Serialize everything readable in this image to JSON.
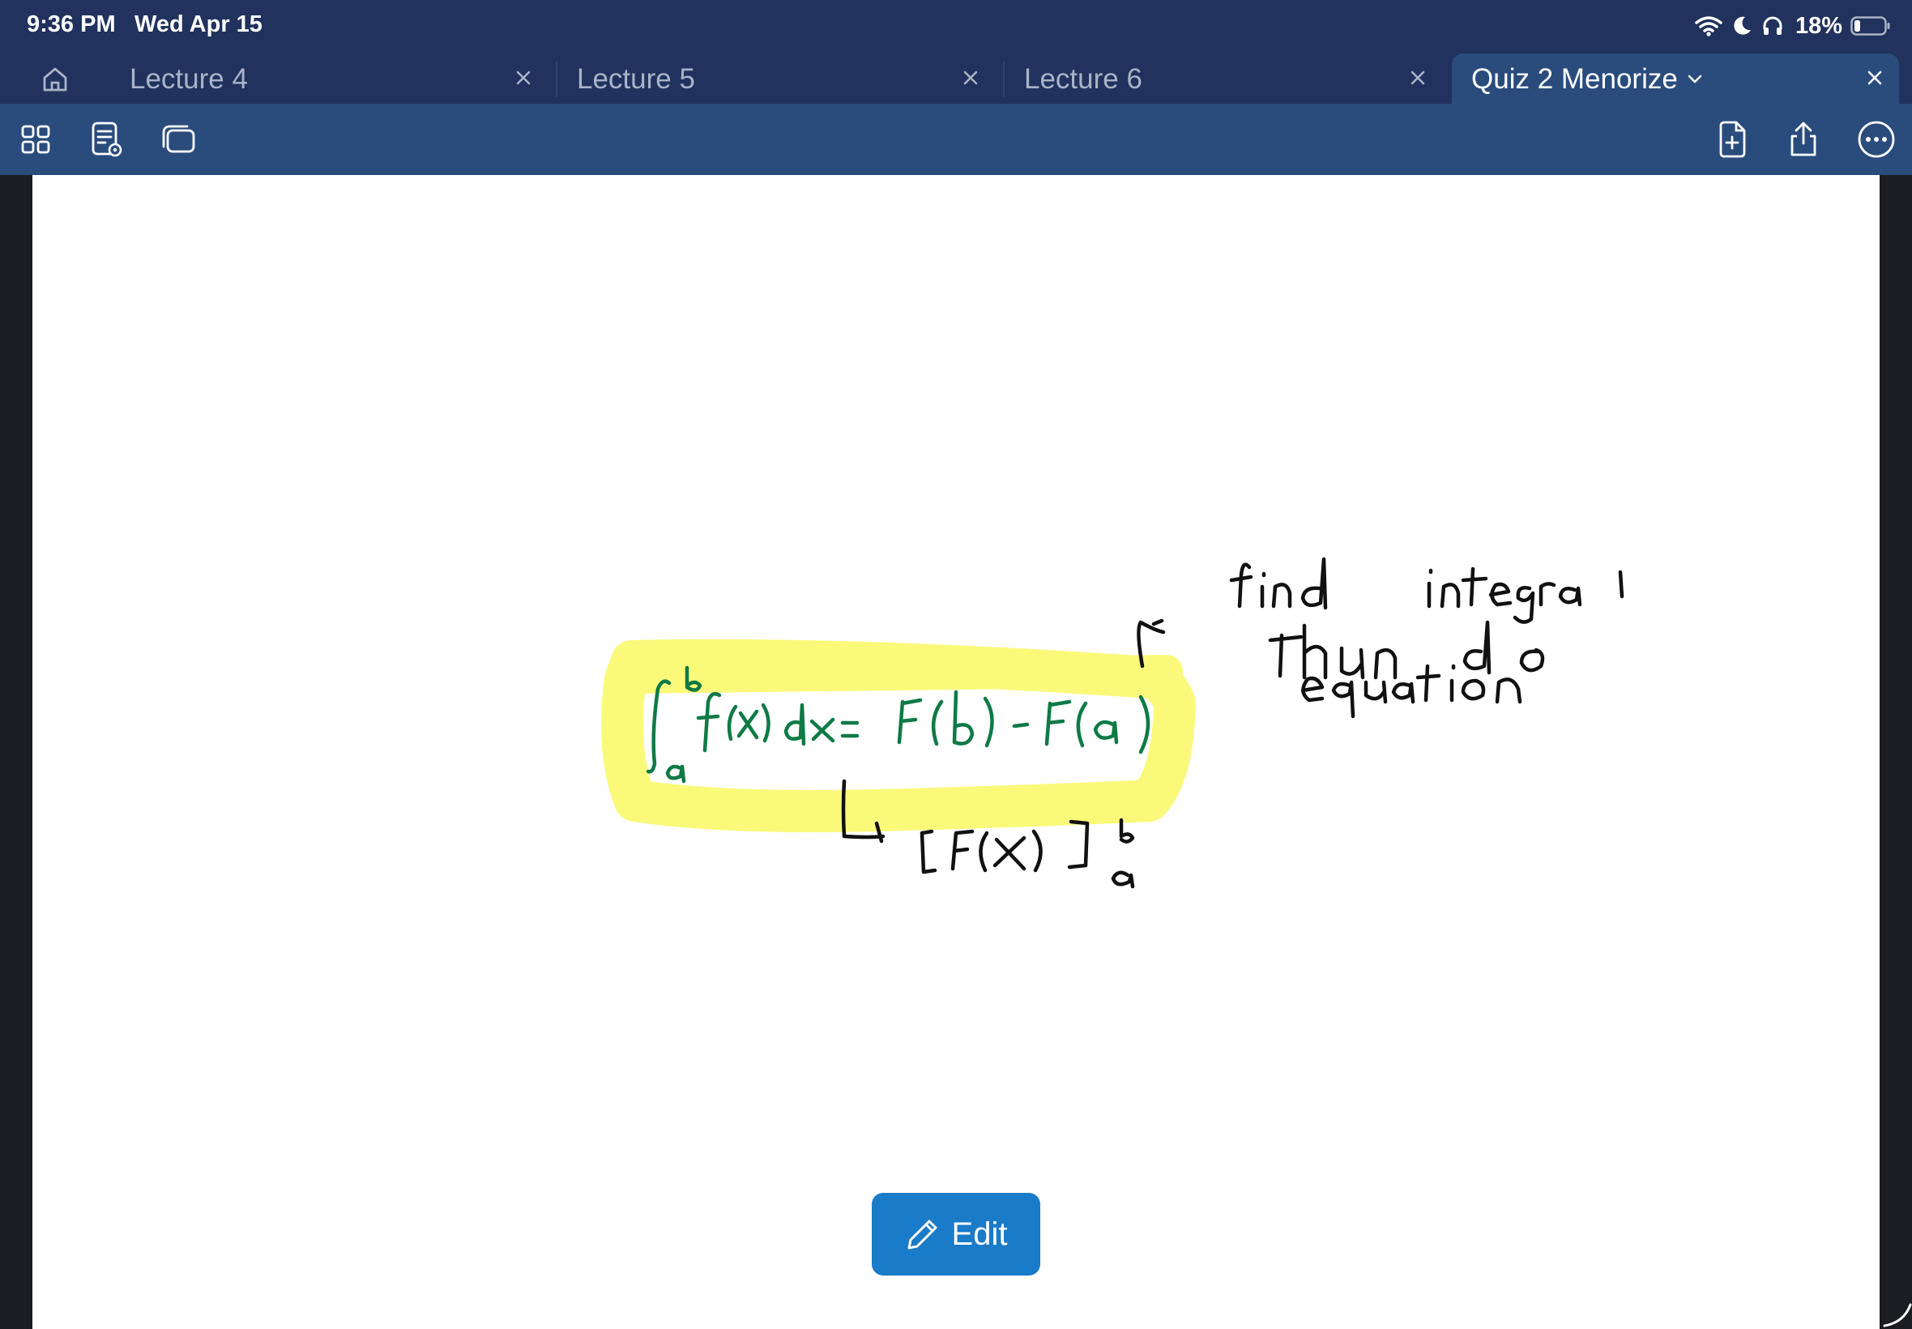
{
  "status_bar": {
    "time": "9:36 PM",
    "date": "Wed Apr 15",
    "battery_percent": "18%",
    "icons": [
      "wifi-icon",
      "moon-icon",
      "headphones-icon",
      "battery-icon"
    ]
  },
  "tabs": [
    {
      "label": "Lecture 4",
      "active": false
    },
    {
      "label": "Lecture 5",
      "active": false
    },
    {
      "label": "Lecture 6",
      "active": false
    },
    {
      "label": "Quiz 2 Menorize",
      "active": true
    }
  ],
  "toolbar": {
    "left_icons": [
      "grid-icon",
      "page-preview-icon",
      "pages-stack-icon"
    ],
    "right_icons": [
      "add-page-icon",
      "share-icon",
      "more-icon"
    ]
  },
  "note": {
    "highlight_color": "#fbf97a",
    "formula_ink_color": "#0f7a45",
    "annotation_ink_color": "#111111"
  },
  "edit_button": {
    "label": "Edit"
  },
  "colors": {
    "chrome": "#20325d",
    "toolbar": "#2a4c7d",
    "edit_button": "#1a7bc8"
  }
}
